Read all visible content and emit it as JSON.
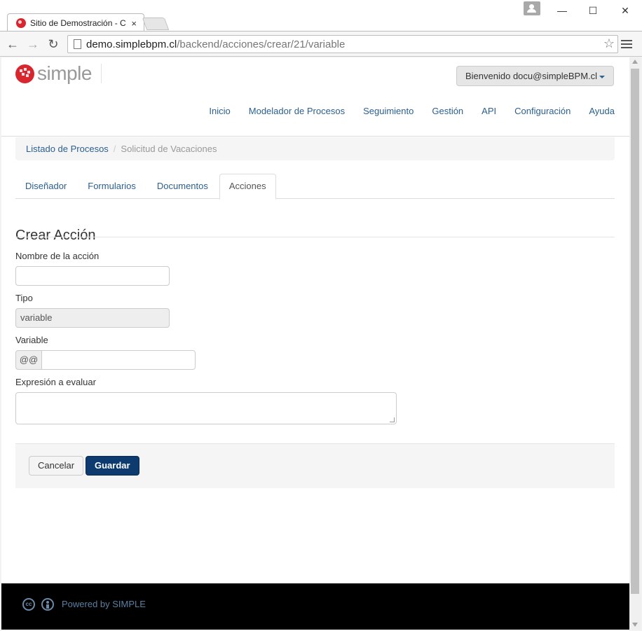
{
  "browser": {
    "tab_title": "Sitio de Demostración - C",
    "tab_close": "×",
    "url_host": "demo.simplebpm.cl",
    "url_path": "/backend/acciones/crear/21/variable",
    "window_controls": {
      "minimize": "—",
      "maximize": "☐",
      "close": "✕"
    },
    "icons": {
      "back": "back-arrow-icon",
      "forward": "forward-arrow-icon",
      "reload": "reload-icon",
      "star": "star-icon",
      "menu": "hamburger-menu-icon"
    }
  },
  "header": {
    "brand": "simple",
    "welcome": "Bienvenido docu@simpleBPM.cl",
    "nav": [
      "Inicio",
      "Modelador de Procesos",
      "Seguimiento",
      "Gestión",
      "API",
      "Configuración",
      "Ayuda"
    ]
  },
  "breadcrumb": {
    "link": "Listado de Procesos",
    "separator": "/",
    "current": "Solicitud de Vacaciones"
  },
  "tabs": {
    "items": [
      "Diseñador",
      "Formularios",
      "Documentos",
      "Acciones"
    ],
    "active": "Acciones"
  },
  "form": {
    "title": "Crear Acción",
    "name_label": "Nombre de la acción",
    "name_value": "",
    "type_label": "Tipo",
    "type_value": "variable",
    "variable_label": "Variable",
    "variable_prefix": "@@",
    "variable_value": "",
    "expression_label": "Expresión a evaluar",
    "expression_value": "",
    "cancel": "Cancelar",
    "save": "Guardar"
  },
  "footer": {
    "cc_icon_text": "cc",
    "powered_by": "Powered by SIMPLE"
  },
  "colors": {
    "link": "#2a5f8f",
    "primary_button": "#0d3b70",
    "brand_red": "#d9262e",
    "footer_bg": "#000000"
  }
}
